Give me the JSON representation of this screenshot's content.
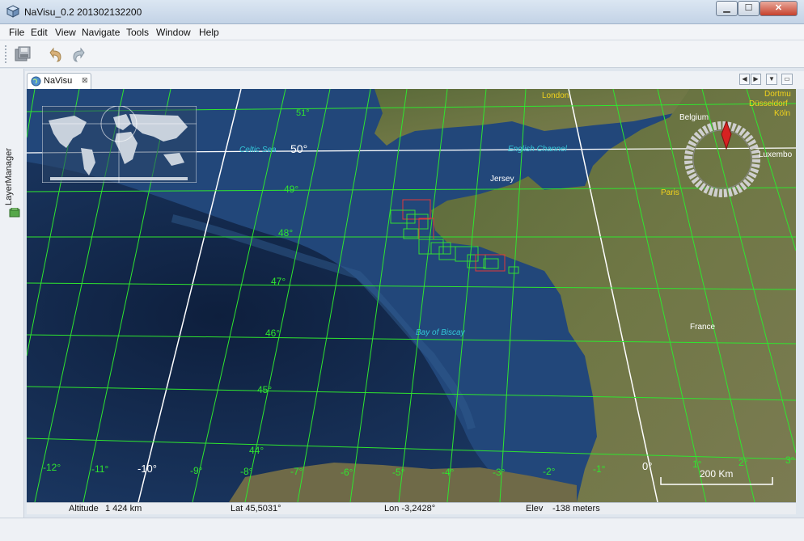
{
  "window": {
    "title": "NaVisu_0.2 201302132200",
    "minimize": "▁",
    "maximize": "☐",
    "close": "✕"
  },
  "menu": [
    "File",
    "Edit",
    "View",
    "Navigate",
    "Tools",
    "Window",
    "Help"
  ],
  "sidebar": {
    "layer_manager": "LayerManager"
  },
  "tab": {
    "label": "NaVisu",
    "close": "⊠"
  },
  "map": {
    "lat_labels": [
      "51°",
      "50°",
      "49°",
      "48°",
      "47°",
      "46°",
      "45°",
      "44°"
    ],
    "lon_labels": [
      "-12°",
      "-11°",
      "-10°",
      "-9°",
      "-8°",
      "-7°",
      "-6°",
      "-5°",
      "-4°",
      "-3°",
      "-2°",
      "-1°",
      "0°",
      "1°",
      "2°",
      "3°"
    ],
    "places": {
      "london": "London",
      "dortmund": "Dortmu",
      "dusseldorf": "Düsseldorf",
      "koln": "Köln",
      "belgium": "Belgium",
      "luxembourg": "Luxembo",
      "paris": "Paris",
      "jersey": "Jersey",
      "france": "France",
      "celtic_sea": "Celtic Sea",
      "english_channel": "English Channel",
      "bay_of_biscay": "Bay of Biscay"
    },
    "scale_label": "200 Km",
    "colors": {
      "grid": "#2fe62f",
      "label": "#2fe62f",
      "meridian": "#ffffff",
      "sea_label": "#33c6d8",
      "city": "#f2d21c"
    }
  },
  "status": {
    "altitude_label": "Altitude",
    "altitude_value": "1 424 km",
    "lat": "Lat 45,5031°",
    "lon": "Lon -3,2428°",
    "elev_label": "Elev",
    "elev_value": "-138 meters"
  }
}
